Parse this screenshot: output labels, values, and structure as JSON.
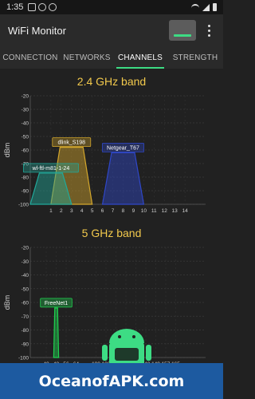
{
  "status_bar": {
    "time": "1:35"
  },
  "app_bar": {
    "title": "WiFi Monitor"
  },
  "tabs": [
    {
      "label": "CONNECTION",
      "active": false
    },
    {
      "label": "NETWORKS",
      "active": false
    },
    {
      "label": "CHANNELS",
      "active": true
    },
    {
      "label": "STRENGTH",
      "active": false
    }
  ],
  "colors": {
    "accent": "#3ddc84",
    "band_title": "#f2c94c"
  },
  "watermark": "OceanofAPK.com",
  "chart_data": [
    {
      "type": "area",
      "title": "2.4 GHz band",
      "ylabel": "dBm",
      "ylim": [
        -100,
        -20
      ],
      "yticks": [
        -20,
        -30,
        -40,
        -50,
        -60,
        -70,
        -80,
        -90,
        -100
      ],
      "xticks": [
        1,
        2,
        3,
        4,
        5,
        6,
        7,
        8,
        9,
        10,
        11,
        12,
        13,
        14
      ],
      "xlim": [
        -1,
        16
      ],
      "series": [
        {
          "name": "dlink_S198",
          "channel": 3,
          "width": 4,
          "level": -58,
          "color": "#d4a72c"
        },
        {
          "name": "Netgear_T67",
          "channel": 8,
          "width": 4,
          "level": -62,
          "color": "#2f47c8"
        },
        {
          "name": "wl-ftl-m81-1-24",
          "channel": 1,
          "width": 4,
          "level": -77,
          "color": "#21a89a"
        }
      ]
    },
    {
      "type": "area",
      "title": "5 GHz band",
      "ylabel": "dBm",
      "ylim": [
        -100,
        -20
      ],
      "yticks": [
        -20,
        -30,
        -40,
        -50,
        -60,
        -70,
        -80,
        -90,
        -100
      ],
      "xticks": [
        40,
        48,
        56,
        64,
        100,
        108,
        116,
        124,
        132,
        140,
        149,
        157,
        165
      ],
      "series": [
        {
          "name": "FreeNet1",
          "channel": 48,
          "width": 4,
          "level": -64,
          "color": "#1fd14f"
        }
      ]
    }
  ]
}
